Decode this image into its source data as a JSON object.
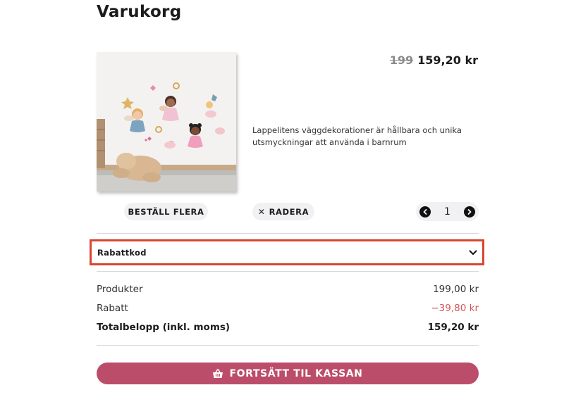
{
  "page": {
    "title": "Varukorg"
  },
  "product": {
    "old_price": "199",
    "new_price": "159,20 kr",
    "description": "Lappelitens väggdekorationer är hållbara och unika utsmyckningar att använda i barnrum",
    "order_more_label": "BESTÄLL FLERA",
    "delete_label": "RADERA",
    "quantity": "1"
  },
  "discount": {
    "label": "Rabattkod"
  },
  "summary": {
    "products_label": "Produkter",
    "products_value": "199,00 kr",
    "discount_label": "Rabatt",
    "discount_value": "−39,80 kr",
    "total_label": "Totalbelopp (inkl. moms)",
    "total_value": "159,20 kr"
  },
  "checkout": {
    "label": "FORTSÄTT TIL KASSAN"
  },
  "colors": {
    "accent": "#bc4d6a",
    "highlight": "#d8452f",
    "discount_text": "#d4575b"
  },
  "icons": [
    "close-icon",
    "chevron-left-icon",
    "chevron-right-icon",
    "chevron-down-icon",
    "basket-icon"
  ]
}
